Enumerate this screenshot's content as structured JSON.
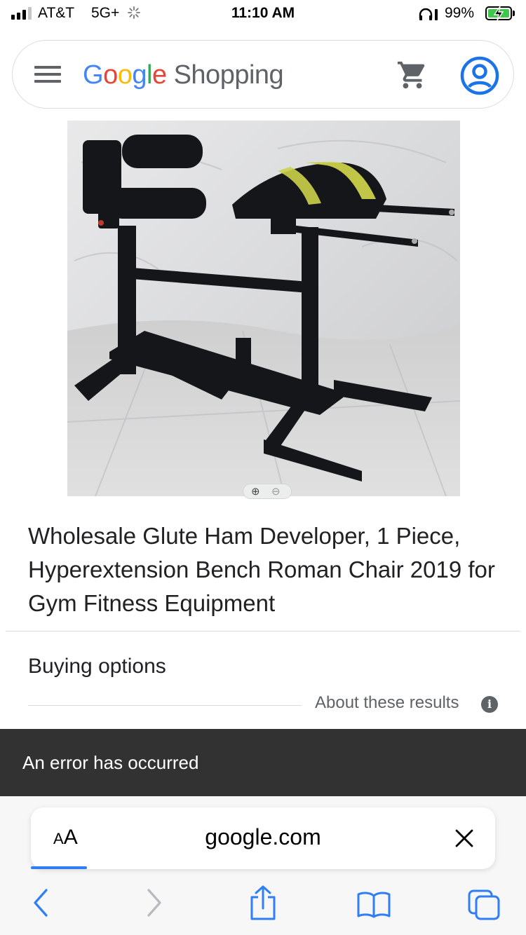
{
  "status_bar": {
    "carrier": "AT&T",
    "network": "5G+",
    "time": "11:10 AM",
    "battery": "99%"
  },
  "header": {
    "logo_brand": [
      "G",
      "o",
      "o",
      "g",
      "l",
      "e"
    ],
    "logo_colors": [
      "#4285F4",
      "#EA4335",
      "#FBBC05",
      "#4285F4",
      "#34A853",
      "#EA4335"
    ],
    "logo_suffix": "Shopping",
    "icons": [
      "menu-icon",
      "shopping-cart-icon",
      "account-icon"
    ]
  },
  "product": {
    "image_alt_icon": "product-photo",
    "title": "Wholesale Glute Ham Developer, 1 Piece, Hyperextension Bench Roman Chair 2019 for Gym Fitness Equipment"
  },
  "buying_options": {
    "heading": "Buying options",
    "about_link": "About these results"
  },
  "error_banner": {
    "message": "An error has occurred"
  },
  "browser": {
    "text_size_label_small": "A",
    "text_size_label_large": "A",
    "url": "google.com",
    "colors": {
      "accent": "#2f7ef6",
      "nav_disabled": "#b9b9be"
    }
  }
}
